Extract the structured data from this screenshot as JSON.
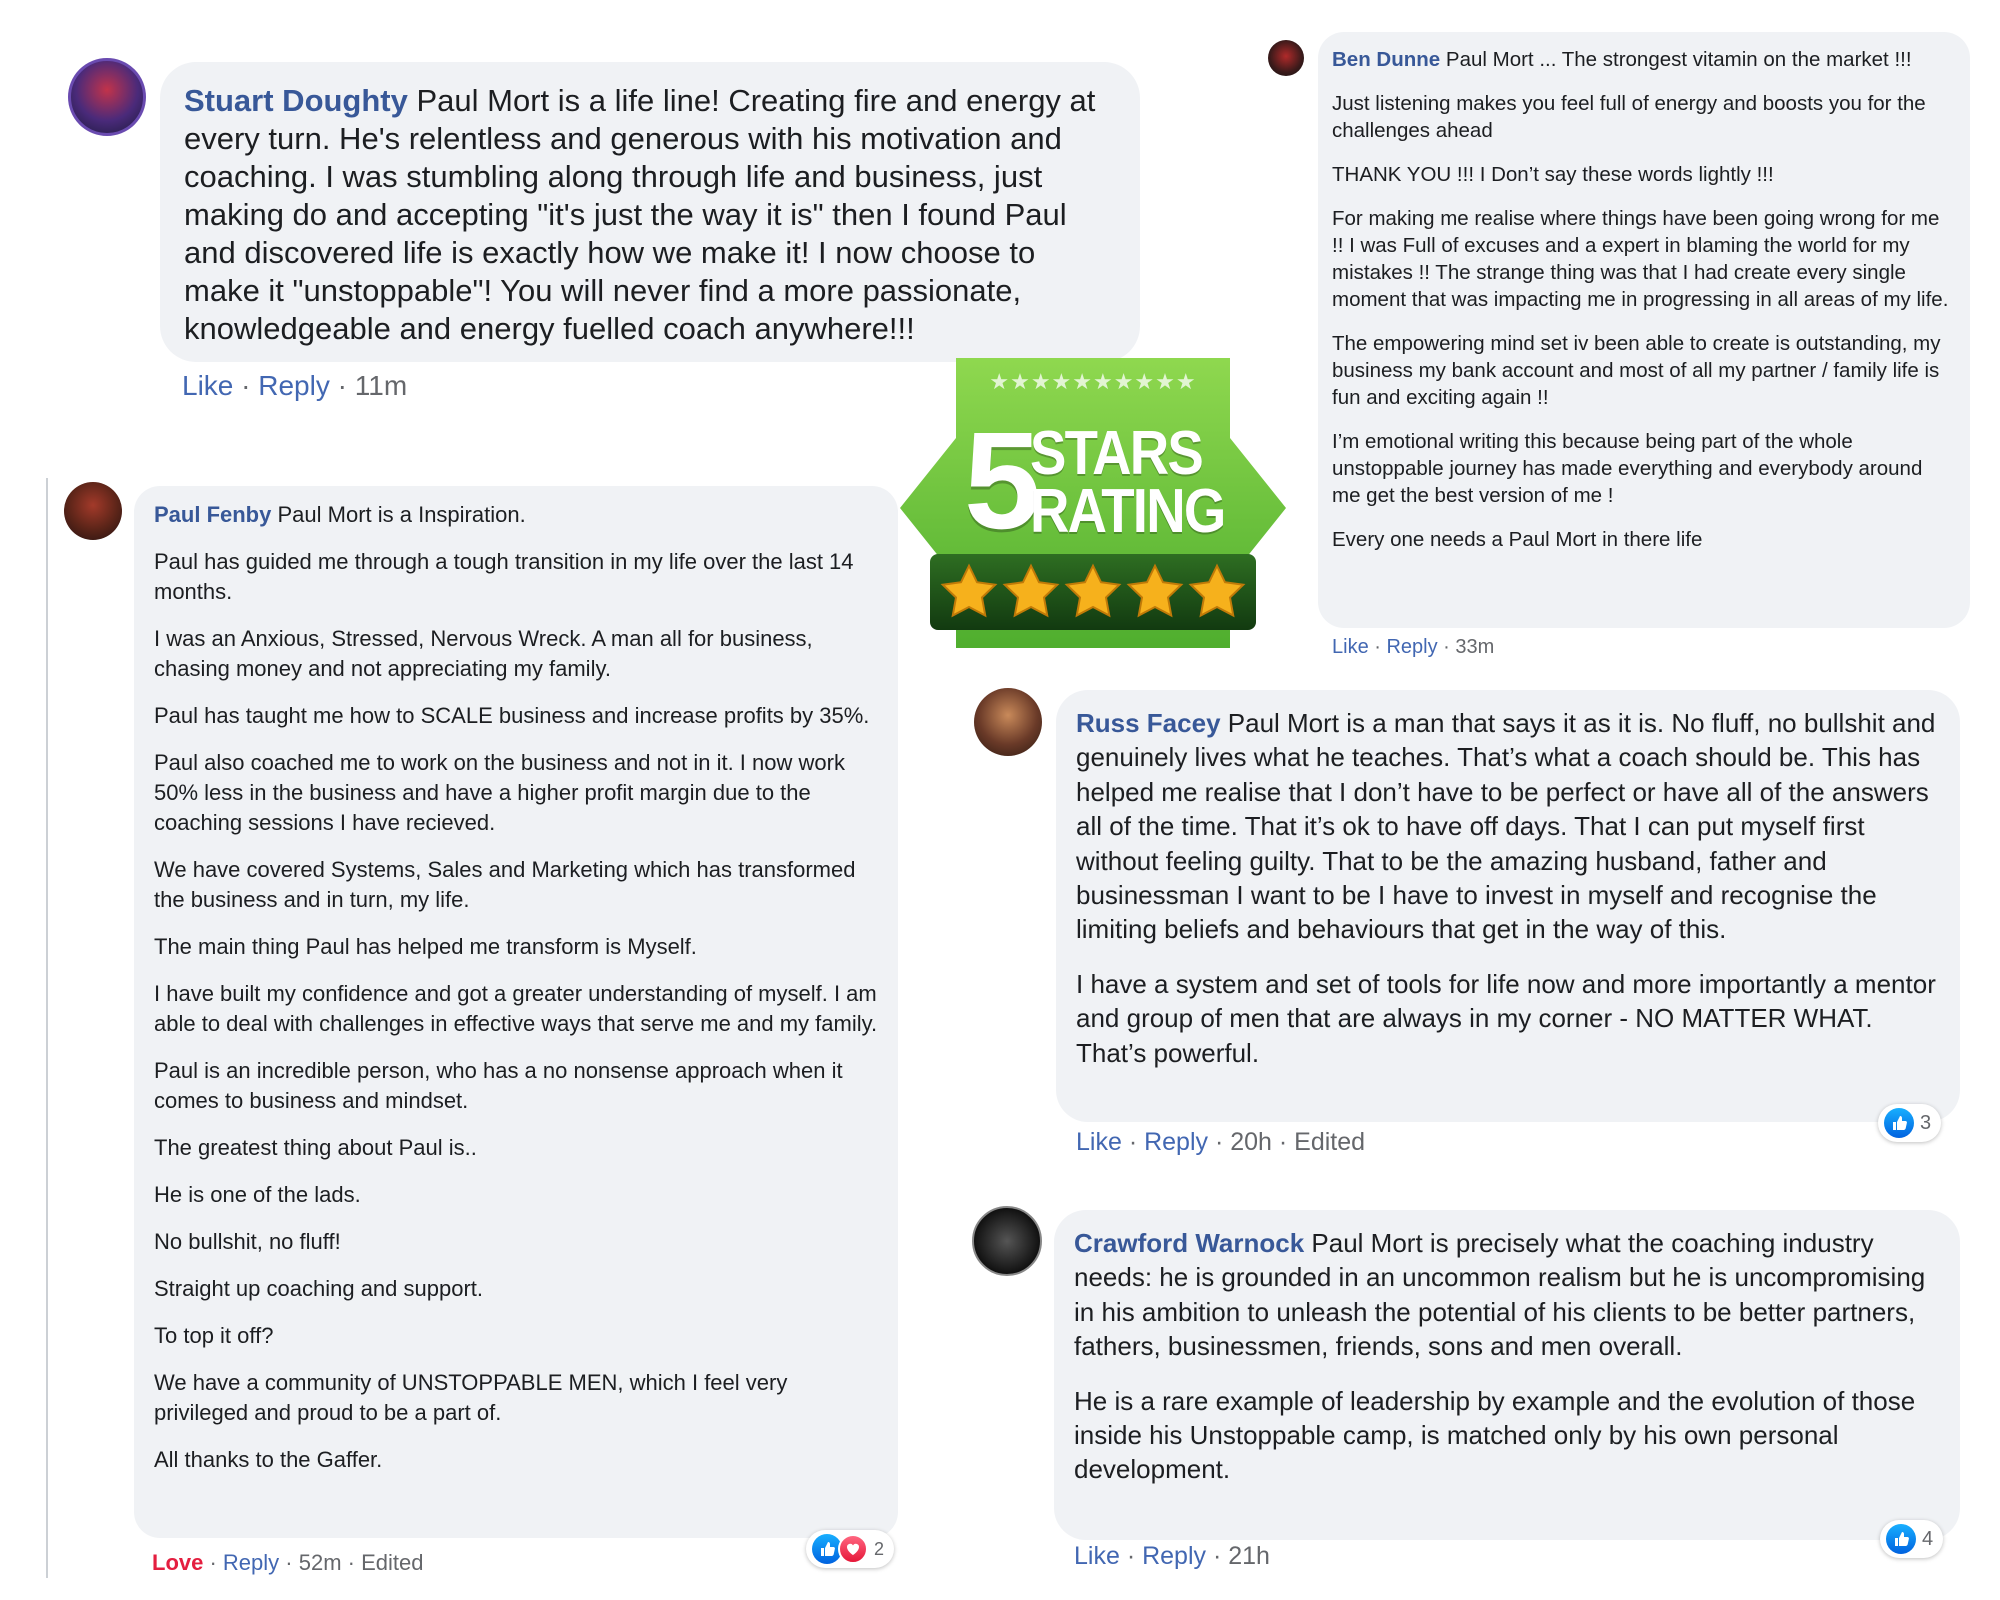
{
  "reviews": [
    {
      "author": "Stuart Doughty",
      "paragraphs": [
        "Paul Mort is a life line! Creating fire and energy at every turn. He's relentless and generous with his motivation and coaching. I was stumbling along through life and business, just making do and accepting \"it's just the way it is\" then I found Paul and discovered life is exactly how we make it! I now choose to make it \"unstoppable\"! You will never find a more passionate, knowledgeable and energy fuelled coach anywhere!!!"
      ],
      "actions": {
        "like": "Like",
        "reply": "Reply",
        "time": "11m"
      }
    },
    {
      "author": "Paul Fenby",
      "paragraphs": [
        "Paul Mort is a Inspiration.",
        "Paul has guided me through a tough transition in my life over the last 14 months.",
        "I was an Anxious, Stressed, Nervous Wreck. A man all for business, chasing money and not appreciating my family.",
        "Paul has taught me how to SCALE business and increase profits by 35%.",
        "Paul also coached me to work on the business and not in it. I now work 50% less in the business and have a higher profit margin due to the coaching sessions I have recieved.",
        "We have covered Systems, Sales and Marketing which has transformed the business and in turn, my life.",
        "The main thing Paul has helped me transform is Myself.",
        "I have built my confidence and got a greater understanding of myself. I am able to deal with challenges in effective ways that serve me and my family.",
        "Paul is an incredible person, who has a no nonsense approach when it comes to business and mindset.",
        "The greatest thing about Paul is..",
        "He is one of the lads.",
        "No bullshit, no fluff!",
        "Straight up coaching and support.",
        "To top it off?",
        "We have a community of UNSTOPPABLE MEN, which I feel very privileged and proud to be a part of.",
        "All thanks to the Gaffer."
      ],
      "actions": {
        "like": "Love",
        "reply": "Reply",
        "time": "52m",
        "edited": "Edited"
      },
      "reactions": "2"
    },
    {
      "author": "Ben Dunne",
      "paragraphs": [
        "Paul Mort ... The strongest vitamin on the market !!!",
        "Just listening makes you feel full of energy and boosts you for the challenges ahead",
        "THANK YOU !!! I Don’t say these words lightly !!!",
        "For making me realise where things have been going wrong for me !! I was Full of excuses and a expert in blaming the world for my mistakes !! The strange thing was that I had create every single moment that was impacting me in progressing in all areas of my life.",
        "The empowering mind set iv been able to create is outstanding, my business my bank account and most of all my partner / family life is fun and exciting again !!",
        "I’m emotional writing this because being part of the whole unstoppable journey has made everything and everybody around me get the best version of me !",
        "Every one needs a Paul Mort in there life"
      ],
      "actions": {
        "like": "Like",
        "reply": "Reply",
        "time": "33m"
      }
    },
    {
      "author": "Russ Facey",
      "paragraphs": [
        "Paul Mort is a man that says it as it is. No fluff, no bullshit and genuinely lives what he teaches. That’s what a coach should be. This has helped me realise that I don’t have to be perfect or have all of the answers all of the time. That it’s ok to have off days. That I can put myself first without feeling guilty. That to be the amazing husband, father and businessman I want to be I have to invest in myself and recognise the limiting beliefs and behaviours that get in the way of this.",
        "I have a system and set of tools for life now and more importantly a mentor and group of men that are always in my corner - NO MATTER WHAT. That’s powerful."
      ],
      "actions": {
        "like": "Like",
        "reply": "Reply",
        "time": "20h",
        "edited": "Edited"
      },
      "reactions": "3"
    },
    {
      "author": "Crawford Warnock",
      "paragraphs": [
        "Paul Mort is precisely what the coaching industry needs: he is grounded in an uncommon realism but he is uncompromising in his ambition to unleash the potential of his clients to be better partners, fathers, businessmen, friends, sons and men overall.",
        "He is a rare example of leadership by example and the evolution of those inside his Unstoppable camp, is matched only by his own personal development."
      ],
      "actions": {
        "like": "Like",
        "reply": "Reply",
        "time": "21h"
      },
      "reactions": "4"
    }
  ],
  "badge": {
    "number": "5",
    "line1": "STARS",
    "line2": "RATING",
    "small_stars": "★★★★★★★★★★",
    "gold_star_count": 5,
    "colors": {
      "green": "#62c23a",
      "dark_green": "#1f5a1a",
      "gold": "#f6b11c"
    }
  },
  "colors": {
    "author": "#385898",
    "action": "#4267b2",
    "love": "#e41e3f",
    "bubble": "#f0f2f5",
    "muted": "#65676b"
  },
  "separator": " · "
}
